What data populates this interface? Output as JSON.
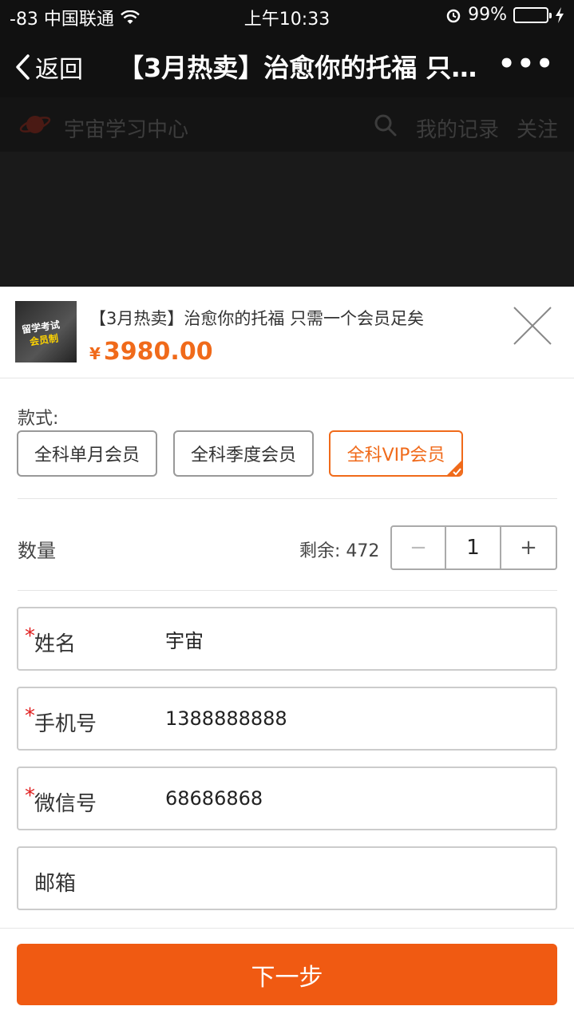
{
  "status_bar": {
    "carrier": "-83 中国联通",
    "time": "上午10:33",
    "battery": "99%"
  },
  "nav": {
    "back_label": "返回",
    "title": "【3月热卖】治愈你的托福 只…",
    "more": "•••"
  },
  "background_page": {
    "site_name": "宇宙学习中心",
    "links": [
      "我的记录",
      "关注"
    ]
  },
  "product": {
    "thumb_line1": "留学考试",
    "thumb_line2": "会员制",
    "title": "【3月热卖】治愈你的托福 只需一个会员足矣",
    "currency": "¥",
    "price": "3980.00"
  },
  "style": {
    "label": "款式:",
    "options": [
      "全科单月会员",
      "全科季度会员",
      "全科VIP会员"
    ],
    "selected_index": 2
  },
  "quantity": {
    "label": "数量",
    "stock_text": "剩余: 472",
    "minus": "−",
    "value": "1",
    "plus": "+"
  },
  "form": {
    "required_mark": "*",
    "fields": [
      {
        "label": "姓名",
        "value": "宇宙",
        "required": true
      },
      {
        "label": "手机号",
        "value": "1388888888",
        "required": true
      },
      {
        "label": "微信号",
        "value": "68686868",
        "required": true
      },
      {
        "label": "邮箱",
        "value": "",
        "required": false
      }
    ]
  },
  "next_button": "下一步",
  "colors": {
    "accent": "#f06a1a",
    "button": "#f05a12",
    "required": "#e02020",
    "nav_bg": "#111111"
  }
}
